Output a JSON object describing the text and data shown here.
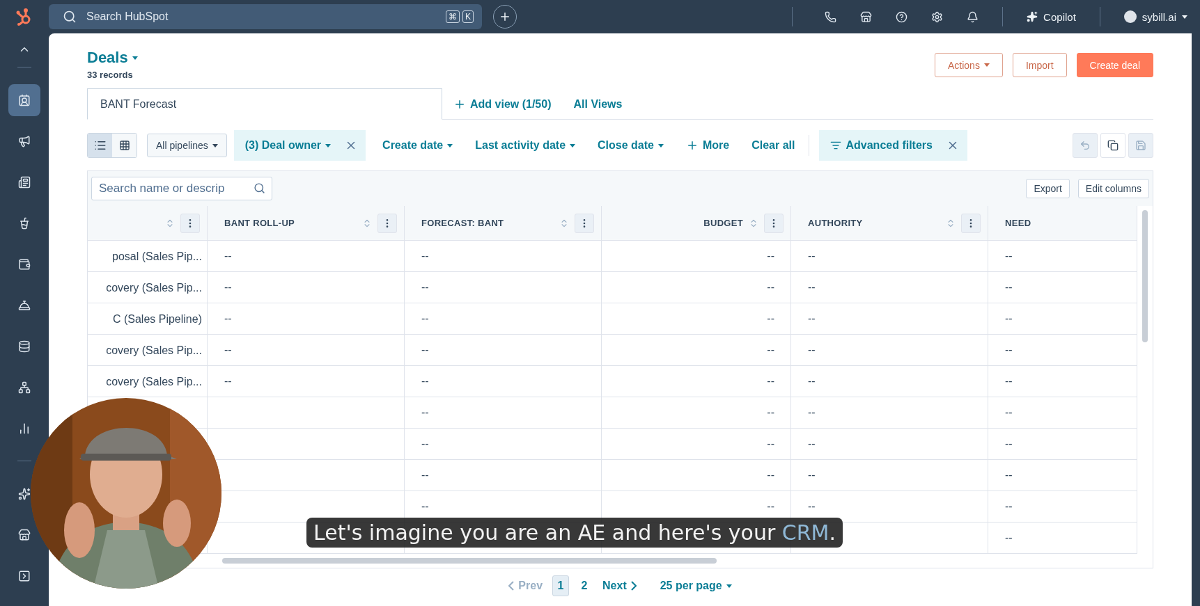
{
  "top_bar": {
    "search": {
      "placeholder": "Search HubSpot"
    },
    "shortcut_keys": [
      "⌘",
      "K"
    ],
    "copilot": "Copilot",
    "account": "sybill.ai"
  },
  "sidebar": {
    "items": [
      {
        "selected": true
      },
      {
        "selected": false
      },
      {
        "selected": false
      },
      {
        "selected": false
      },
      {
        "selected": false
      },
      {
        "selected": false
      },
      {
        "selected": false
      },
      {
        "selected": false
      },
      {
        "selected": false
      },
      {
        "selected": false
      },
      {
        "selected": false
      },
      {
        "selected": false
      }
    ]
  },
  "header": {
    "title": "Deals",
    "subtitle": "33 records",
    "actions": [
      {
        "label": "Actions",
        "kind": "dropdown"
      },
      {
        "label": "Import",
        "kind": "outline"
      },
      {
        "label": "Create deal",
        "kind": "primary"
      }
    ]
  },
  "views": {
    "tabs": [
      {
        "label": "BANT Forecast",
        "selected": true
      }
    ],
    "add_view": "Add view (1/50)",
    "all_views": "All Views"
  },
  "filters": {
    "layout_toggle": [
      {
        "selected": true
      },
      {
        "selected": false
      }
    ],
    "pipeline": "All pipelines",
    "items": [
      {
        "label": "(3) Deal owner",
        "kind": "active"
      },
      {
        "label": "Create date",
        "kind": "dropdown"
      },
      {
        "label": "Last activity date",
        "kind": "dropdown"
      },
      {
        "label": "Close date",
        "kind": "dropdown"
      },
      {
        "label": "More",
        "kind": "add"
      },
      {
        "label": "Clear all",
        "kind": "link"
      }
    ],
    "advanced": "Advanced filters",
    "toolbar": [
      {
        "disabled": true
      },
      {
        "disabled": false
      },
      {
        "disabled": true
      }
    ]
  },
  "table": {
    "search": {
      "placeholder": "Search name or descrip"
    },
    "actions": [
      "Export",
      "Edit columns"
    ],
    "columns": [
      {
        "kind": "stage"
      },
      {
        "label": "BANT ROLL-UP",
        "kind": "text"
      },
      {
        "label": "FORECAST: BANT",
        "kind": "text"
      },
      {
        "label": "BUDGET",
        "kind": "number"
      },
      {
        "label": "AUTHORITY",
        "kind": "text"
      },
      {
        "label": "NEED",
        "kind": "partial"
      }
    ],
    "rows": [
      {
        "cells": [
          "posal (Sales Pip...",
          "--",
          "--",
          "--",
          "--",
          "--"
        ]
      },
      {
        "cells": [
          "covery (Sales Pip...",
          "--",
          "--",
          "--",
          "--",
          "--"
        ]
      },
      {
        "cells": [
          "C (Sales Pipeline)",
          "--",
          "--",
          "--",
          "--",
          "--"
        ]
      },
      {
        "cells": [
          "covery (Sales Pip...",
          "--",
          "--",
          "--",
          "--",
          "--"
        ]
      },
      {
        "cells": [
          "covery (Sales Pip...",
          "--",
          "--",
          "--",
          "--",
          "--"
        ]
      },
      {
        "cells": [
          null,
          null,
          "--",
          "--",
          "--",
          "--"
        ]
      },
      {
        "cells": [
          null,
          null,
          "--",
          "--",
          "--",
          "--"
        ]
      },
      {
        "cells": [
          null,
          null,
          "--",
          "--",
          "--",
          "--"
        ]
      },
      {
        "cells": [
          null,
          null,
          "--",
          "--",
          "--",
          "--"
        ]
      },
      {
        "cells": [
          null,
          null,
          null,
          null,
          null,
          "--"
        ]
      }
    ]
  },
  "pagination": {
    "prev": {
      "label": "Prev",
      "disabled": true
    },
    "pages": [
      {
        "label": "1",
        "selected": true
      },
      {
        "label": "2",
        "selected": false
      }
    ],
    "next": {
      "label": "Next",
      "disabled": false
    },
    "per_page": "25 per page"
  },
  "caption": {
    "text": "Let's imagine you are an AE and here's your ",
    "highlight": "CRM",
    "end": "."
  }
}
